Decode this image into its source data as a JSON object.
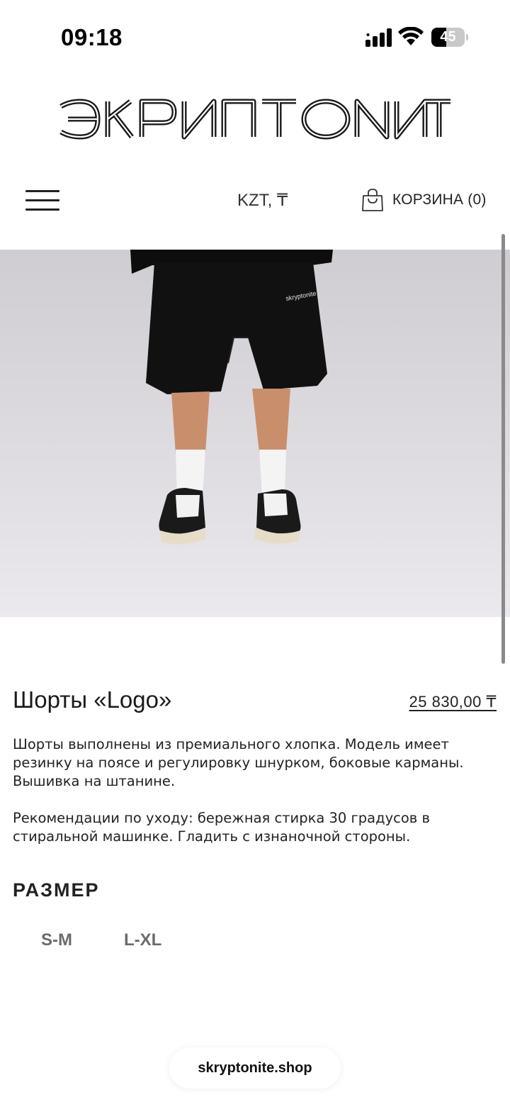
{
  "status_bar": {
    "time": "09:18",
    "battery_level": "45",
    "signal_icon": "cellular-signal-icon",
    "wifi_icon": "wifi-icon"
  },
  "header": {
    "logo_text": "ЭКРИПТОNИТ",
    "menu_icon": "hamburger-menu-icon",
    "currency_label": "KZT, ₸",
    "cart_icon": "shopping-bag-icon",
    "cart_label": "КОРЗИНА (0)"
  },
  "product": {
    "image_description_icon": "product-photo",
    "title": "Шорты «Logo»",
    "price": "25 830,00 ₸",
    "description_1": "Шорты выполнены из премиального хлопка. Модель имеет резинку на поясе и регулировку шнурком, боковые карманы. Вышивка на штанине.",
    "description_2": "Рекомендации по уходу: бережная стирка 30 градусов в стиральной машинке. Гладить с изнаночной стороны.",
    "size_heading": "РАЗМЕР",
    "sizes": [
      "S-M",
      "L-XL"
    ]
  },
  "browser": {
    "domain": "skryptonite.shop"
  },
  "colors": {
    "background": "#ffffff",
    "text": "#1a1a1a",
    "size_option": "#6b6b6b",
    "photo_backdrop": "#e4e2e6"
  }
}
